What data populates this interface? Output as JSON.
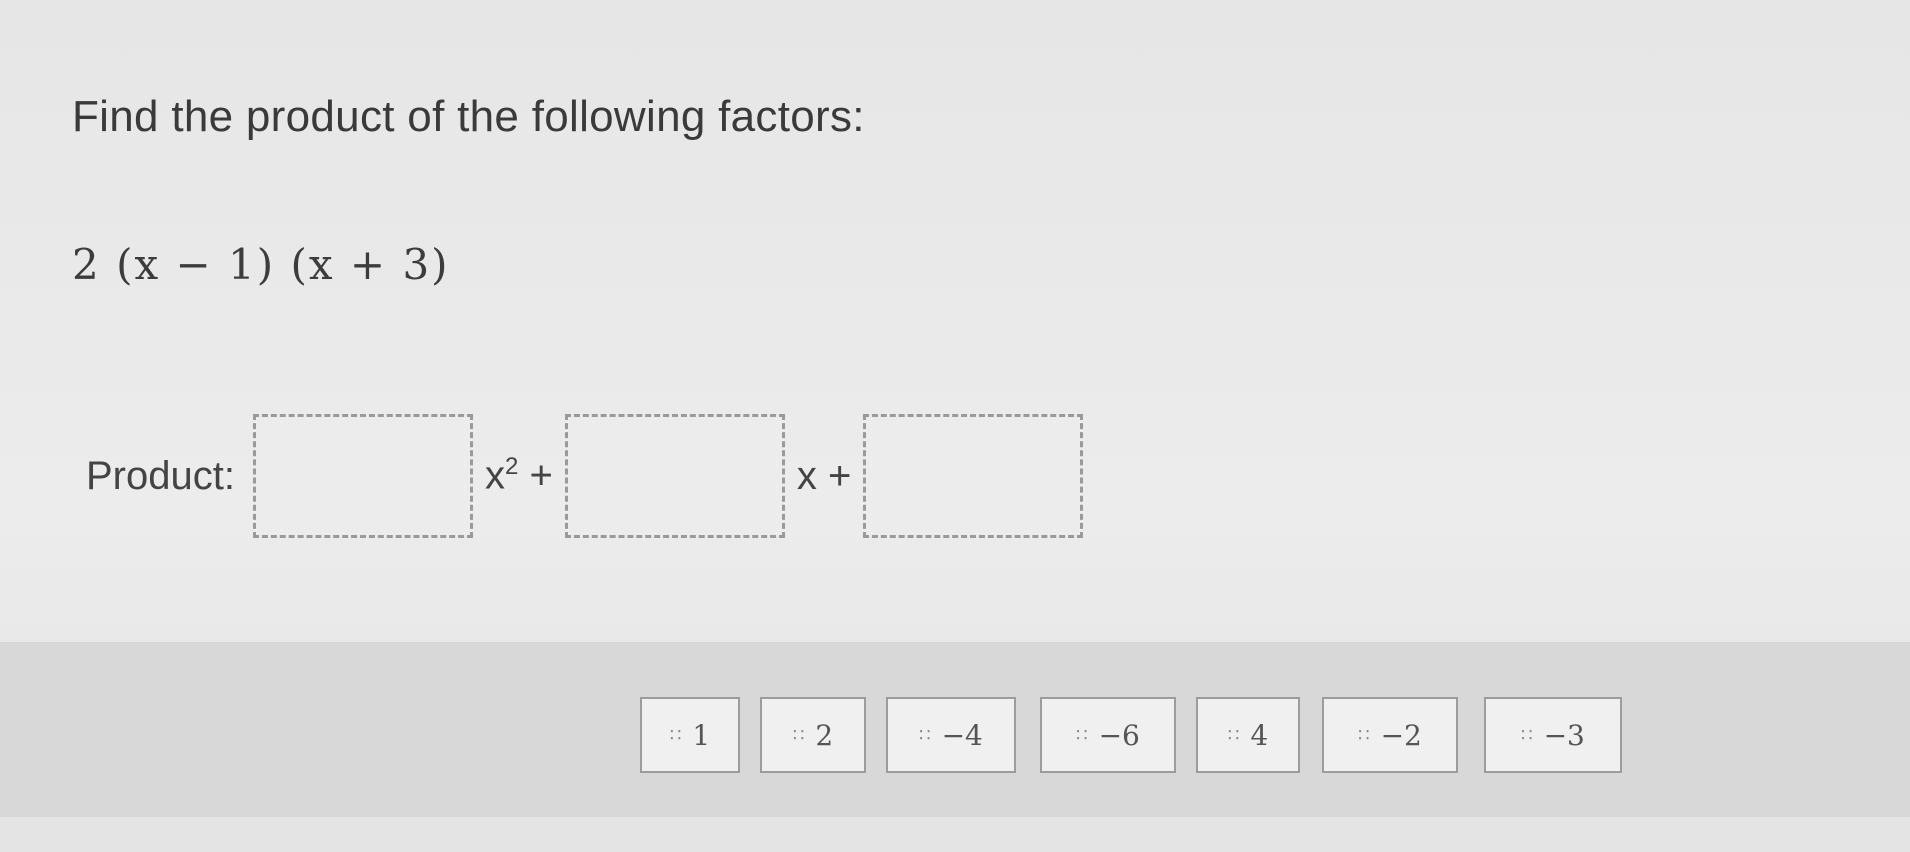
{
  "prompt": "Find the product of the following factors:",
  "expression": "2 (x − 1) (x + 3)",
  "product": {
    "label": "Product:",
    "term_x2": "x",
    "exp": "2",
    "plus1": "+",
    "term_x": "x",
    "plus2": "+"
  },
  "tiles": [
    {
      "value": "1",
      "grip": "∷"
    },
    {
      "value": "2",
      "grip": "∷"
    },
    {
      "value": "−4",
      "grip": "∷"
    },
    {
      "value": "−6",
      "grip": "∷"
    },
    {
      "value": "4",
      "grip": "∷"
    },
    {
      "value": "−2",
      "grip": "∷"
    },
    {
      "value": "−3",
      "grip": "∷"
    }
  ]
}
